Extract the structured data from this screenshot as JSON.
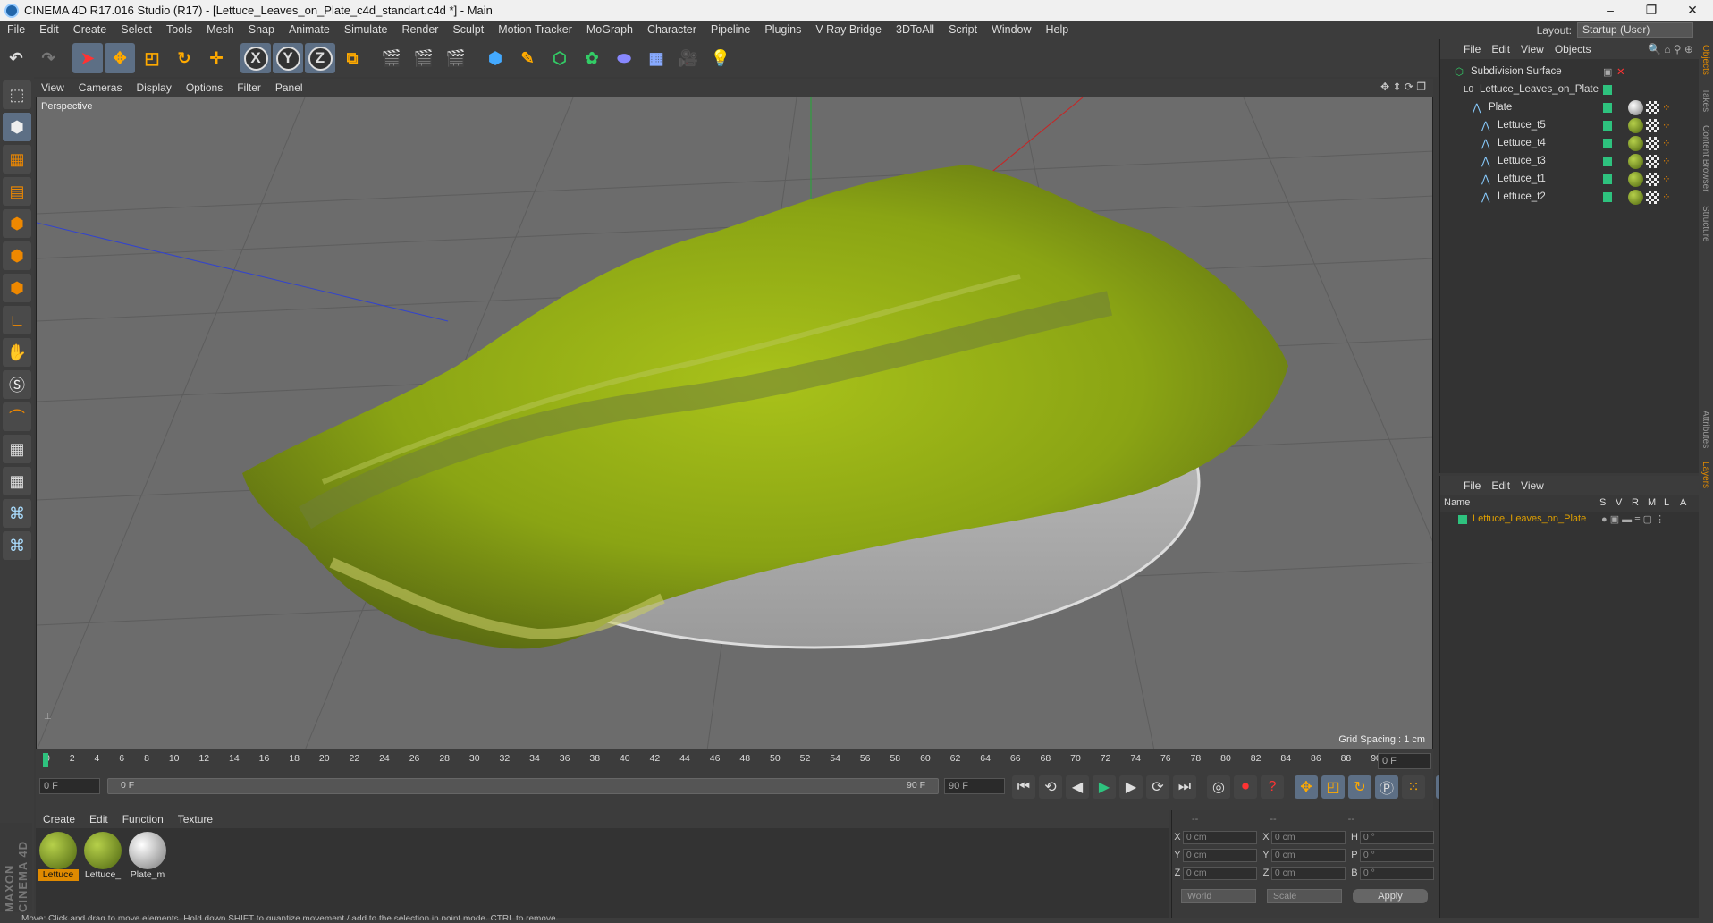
{
  "window": {
    "title": "CINEMA 4D R17.016 Studio (R17) - [Lettuce_Leaves_on_Plate_c4d_standart.c4d *] - Main",
    "buttons": [
      "–",
      "❐",
      "✕"
    ]
  },
  "menubar": {
    "items": [
      "File",
      "Edit",
      "Create",
      "Select",
      "Tools",
      "Mesh",
      "Snap",
      "Animate",
      "Simulate",
      "Render",
      "Sculpt",
      "Motion Tracker",
      "MoGraph",
      "Character",
      "Pipeline",
      "Plugins",
      "V-Ray Bridge",
      "3DToAll",
      "Script",
      "Window",
      "Help"
    ],
    "layout_label": "Layout:",
    "layout_value": "Startup (User)"
  },
  "viewport": {
    "menu": [
      "View",
      "Cameras",
      "Display",
      "Options",
      "Filter",
      "Panel"
    ],
    "label": "Perspective",
    "grid_info": "Grid Spacing : 1 cm"
  },
  "timeline": {
    "ticks": [
      "0",
      "2",
      "4",
      "6",
      "8",
      "10",
      "12",
      "14",
      "16",
      "18",
      "20",
      "22",
      "24",
      "26",
      "28",
      "30",
      "32",
      "34",
      "36",
      "38",
      "40",
      "42",
      "44",
      "46",
      "48",
      "50",
      "52",
      "54",
      "56",
      "58",
      "60",
      "62",
      "64",
      "66",
      "68",
      "70",
      "72",
      "74",
      "76",
      "78",
      "80",
      "82",
      "84",
      "86",
      "88",
      "90"
    ],
    "current_frame": "0 F"
  },
  "playbar": {
    "start": "0 F",
    "range_start": "0 F",
    "range_end": "90 F",
    "end": "90 F"
  },
  "materials": {
    "menu": [
      "Create",
      "Edit",
      "Function",
      "Texture"
    ],
    "items": [
      {
        "label": "Lettuce",
        "selected": true
      },
      {
        "label": "Lettuce_",
        "selected": false
      },
      {
        "label": "Plate_m",
        "selected": false
      }
    ]
  },
  "coords": {
    "headers": [
      "--",
      "--",
      "--"
    ],
    "rows": [
      {
        "a": "X",
        "av": "0 cm",
        "b": "X",
        "bv": "0 cm",
        "c": "H",
        "cv": "0 °"
      },
      {
        "a": "Y",
        "av": "0 cm",
        "b": "Y",
        "bv": "0 cm",
        "c": "P",
        "cv": "0 °"
      },
      {
        "a": "Z",
        "av": "0 cm",
        "b": "Z",
        "bv": "0 cm",
        "c": "B",
        "cv": "0 °"
      }
    ],
    "world": "World",
    "scale": "Scale",
    "apply": "Apply"
  },
  "objects": {
    "menu": [
      "File",
      "Edit",
      "View",
      "Objects"
    ],
    "tree": [
      {
        "name": "Subdivision Surface",
        "indent": 0
      },
      {
        "name": "Lettuce_Leaves_on_Plate",
        "indent": 1
      },
      {
        "name": "Plate",
        "indent": 2
      },
      {
        "name": "Lettuce_t5",
        "indent": 3
      },
      {
        "name": "Lettuce_t4",
        "indent": 3
      },
      {
        "name": "Lettuce_t3",
        "indent": 3
      },
      {
        "name": "Lettuce_t1",
        "indent": 3
      },
      {
        "name": "Lettuce_t2",
        "indent": 3
      }
    ]
  },
  "layers": {
    "menu": [
      "File",
      "Edit",
      "View"
    ],
    "header_name": "Name",
    "cols": [
      "S",
      "V",
      "R",
      "M",
      "L",
      "A"
    ],
    "row": "Lettuce_Leaves_on_Plate"
  },
  "sidetabs": [
    "Objects",
    "Takes",
    "Content Browser",
    "Structure",
    "Attributes",
    "Layers"
  ],
  "brand": "MAXON CINEMA 4D",
  "status": "Move: Click and drag to move elements. Hold down SHIFT to quantize movement / add to the selection in point mode, CTRL to remove."
}
